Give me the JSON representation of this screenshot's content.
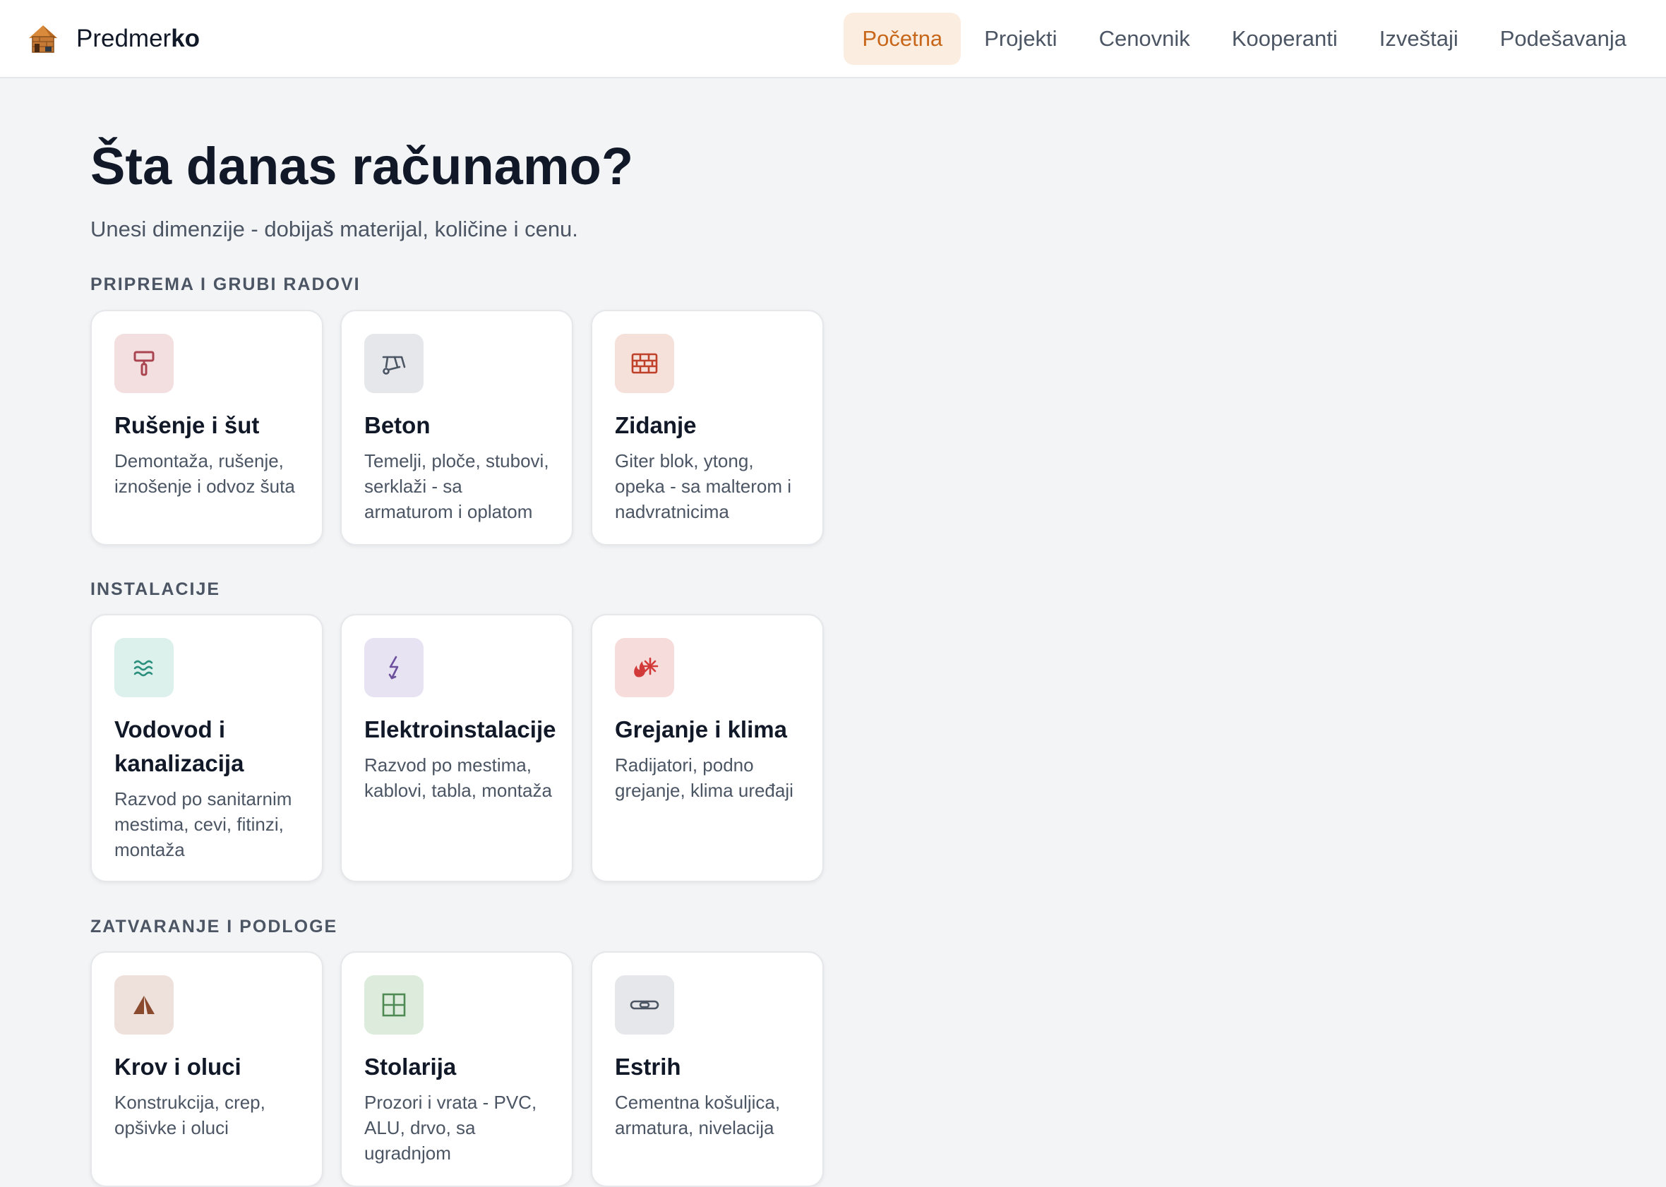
{
  "header": {
    "brand_prefix": "Predmer",
    "brand_suffix": "ko",
    "nav": [
      {
        "label": "Početna",
        "active": true
      },
      {
        "label": "Projekti",
        "active": false
      },
      {
        "label": "Cenovnik",
        "active": false
      },
      {
        "label": "Kooperanti",
        "active": false
      },
      {
        "label": "Izveštaji",
        "active": false
      },
      {
        "label": "Podešavanja",
        "active": false
      }
    ]
  },
  "hero": {
    "title": "Šta danas računamo?",
    "subtitle": "Unesi dimenzije - dobijaš materijal, količine i cenu."
  },
  "sections": [
    {
      "label": "PRIPREMA I GRUBI RADOVI",
      "cards": [
        {
          "title": "Rušenje i šut",
          "desc": "Demontaža, rušenje, iznošenje i odvoz šuta",
          "icon": "paint-roller-icon",
          "icon_bg": "#f3dfe0",
          "icon_color": "#a94450"
        },
        {
          "title": "Beton",
          "desc": "Temelji, ploče, stubovi, serklaži - sa armaturom i oplatom",
          "icon": "wheelbarrow-icon",
          "icon_bg": "#e5e7eb",
          "icon_color": "#4b5563"
        },
        {
          "title": "Zidanje",
          "desc": "Giter blok, ytong, opeka - sa malterom i nadvratnicima",
          "icon": "brick-wall-icon",
          "icon_bg": "#f5e0da",
          "icon_color": "#c0412a"
        }
      ]
    },
    {
      "label": "INSTALACIJE",
      "cards": [
        {
          "title": "Vodovod i kanalizacija",
          "desc": "Razvod po sanitarnim mestima, cevi, fitinzi, montaža",
          "icon": "water-waves-icon",
          "icon_bg": "#dcf1ec",
          "icon_color": "#2b8f7e"
        },
        {
          "title": "Elektroinstalacije",
          "desc": "Razvod po mestima, kablovi, tabla, montaža",
          "icon": "lightning-icon",
          "icon_bg": "#e7e3f2",
          "icon_color": "#6b4f9c"
        },
        {
          "title": "Grejanje i klima",
          "desc": "Radijatori, podno grejanje, klima uređaji",
          "icon": "fire-snowflake-icon",
          "icon_bg": "#f7dcdc",
          "icon_color": "#d23a3a"
        }
      ]
    },
    {
      "label": "ZATVARANJE I PODLOGE",
      "cards": [
        {
          "title": "Krov i oluci",
          "desc": "Konstrukcija, crep, opšivke i oluci",
          "icon": "roof-triangle-icon",
          "icon_bg": "#eee0db",
          "icon_color": "#8a4a2e"
        },
        {
          "title": "Stolarija",
          "desc": "Prozori i vrata - PVC, ALU, drvo, sa ugradnjom",
          "icon": "window-icon",
          "icon_bg": "#dcebdc",
          "icon_color": "#4f8a55"
        },
        {
          "title": "Estrih",
          "desc": "Cementna košuljica, armatura, nivelacija",
          "icon": "level-bar-icon",
          "icon_bg": "#e5e7eb",
          "icon_color": "#4b5563"
        }
      ]
    }
  ]
}
